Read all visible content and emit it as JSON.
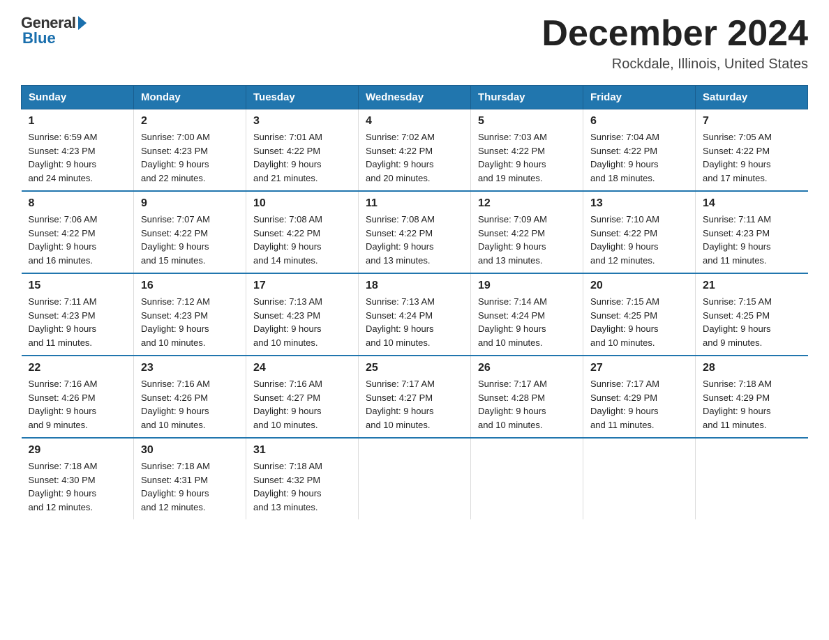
{
  "header": {
    "logo_general": "General",
    "logo_blue": "Blue",
    "month_title": "December 2024",
    "location": "Rockdale, Illinois, United States"
  },
  "days_of_week": [
    "Sunday",
    "Monday",
    "Tuesday",
    "Wednesday",
    "Thursday",
    "Friday",
    "Saturday"
  ],
  "weeks": [
    [
      {
        "num": "1",
        "sunrise": "6:59 AM",
        "sunset": "4:23 PM",
        "daylight": "9 hours and 24 minutes."
      },
      {
        "num": "2",
        "sunrise": "7:00 AM",
        "sunset": "4:23 PM",
        "daylight": "9 hours and 22 minutes."
      },
      {
        "num": "3",
        "sunrise": "7:01 AM",
        "sunset": "4:22 PM",
        "daylight": "9 hours and 21 minutes."
      },
      {
        "num": "4",
        "sunrise": "7:02 AM",
        "sunset": "4:22 PM",
        "daylight": "9 hours and 20 minutes."
      },
      {
        "num": "5",
        "sunrise": "7:03 AM",
        "sunset": "4:22 PM",
        "daylight": "9 hours and 19 minutes."
      },
      {
        "num": "6",
        "sunrise": "7:04 AM",
        "sunset": "4:22 PM",
        "daylight": "9 hours and 18 minutes."
      },
      {
        "num": "7",
        "sunrise": "7:05 AM",
        "sunset": "4:22 PM",
        "daylight": "9 hours and 17 minutes."
      }
    ],
    [
      {
        "num": "8",
        "sunrise": "7:06 AM",
        "sunset": "4:22 PM",
        "daylight": "9 hours and 16 minutes."
      },
      {
        "num": "9",
        "sunrise": "7:07 AM",
        "sunset": "4:22 PM",
        "daylight": "9 hours and 15 minutes."
      },
      {
        "num": "10",
        "sunrise": "7:08 AM",
        "sunset": "4:22 PM",
        "daylight": "9 hours and 14 minutes."
      },
      {
        "num": "11",
        "sunrise": "7:08 AM",
        "sunset": "4:22 PM",
        "daylight": "9 hours and 13 minutes."
      },
      {
        "num": "12",
        "sunrise": "7:09 AM",
        "sunset": "4:22 PM",
        "daylight": "9 hours and 13 minutes."
      },
      {
        "num": "13",
        "sunrise": "7:10 AM",
        "sunset": "4:22 PM",
        "daylight": "9 hours and 12 minutes."
      },
      {
        "num": "14",
        "sunrise": "7:11 AM",
        "sunset": "4:23 PM",
        "daylight": "9 hours and 11 minutes."
      }
    ],
    [
      {
        "num": "15",
        "sunrise": "7:11 AM",
        "sunset": "4:23 PM",
        "daylight": "9 hours and 11 minutes."
      },
      {
        "num": "16",
        "sunrise": "7:12 AM",
        "sunset": "4:23 PM",
        "daylight": "9 hours and 10 minutes."
      },
      {
        "num": "17",
        "sunrise": "7:13 AM",
        "sunset": "4:23 PM",
        "daylight": "9 hours and 10 minutes."
      },
      {
        "num": "18",
        "sunrise": "7:13 AM",
        "sunset": "4:24 PM",
        "daylight": "9 hours and 10 minutes."
      },
      {
        "num": "19",
        "sunrise": "7:14 AM",
        "sunset": "4:24 PM",
        "daylight": "9 hours and 10 minutes."
      },
      {
        "num": "20",
        "sunrise": "7:15 AM",
        "sunset": "4:25 PM",
        "daylight": "9 hours and 10 minutes."
      },
      {
        "num": "21",
        "sunrise": "7:15 AM",
        "sunset": "4:25 PM",
        "daylight": "9 hours and 9 minutes."
      }
    ],
    [
      {
        "num": "22",
        "sunrise": "7:16 AM",
        "sunset": "4:26 PM",
        "daylight": "9 hours and 9 minutes."
      },
      {
        "num": "23",
        "sunrise": "7:16 AM",
        "sunset": "4:26 PM",
        "daylight": "9 hours and 10 minutes."
      },
      {
        "num": "24",
        "sunrise": "7:16 AM",
        "sunset": "4:27 PM",
        "daylight": "9 hours and 10 minutes."
      },
      {
        "num": "25",
        "sunrise": "7:17 AM",
        "sunset": "4:27 PM",
        "daylight": "9 hours and 10 minutes."
      },
      {
        "num": "26",
        "sunrise": "7:17 AM",
        "sunset": "4:28 PM",
        "daylight": "9 hours and 10 minutes."
      },
      {
        "num": "27",
        "sunrise": "7:17 AM",
        "sunset": "4:29 PM",
        "daylight": "9 hours and 11 minutes."
      },
      {
        "num": "28",
        "sunrise": "7:18 AM",
        "sunset": "4:29 PM",
        "daylight": "9 hours and 11 minutes."
      }
    ],
    [
      {
        "num": "29",
        "sunrise": "7:18 AM",
        "sunset": "4:30 PM",
        "daylight": "9 hours and 12 minutes."
      },
      {
        "num": "30",
        "sunrise": "7:18 AM",
        "sunset": "4:31 PM",
        "daylight": "9 hours and 12 minutes."
      },
      {
        "num": "31",
        "sunrise": "7:18 AM",
        "sunset": "4:32 PM",
        "daylight": "9 hours and 13 minutes."
      },
      {
        "num": "",
        "sunrise": "",
        "sunset": "",
        "daylight": ""
      },
      {
        "num": "",
        "sunrise": "",
        "sunset": "",
        "daylight": ""
      },
      {
        "num": "",
        "sunrise": "",
        "sunset": "",
        "daylight": ""
      },
      {
        "num": "",
        "sunrise": "",
        "sunset": "",
        "daylight": ""
      }
    ]
  ],
  "labels": {
    "sunrise": "Sunrise: ",
    "sunset": "Sunset: ",
    "daylight": "Daylight: "
  }
}
